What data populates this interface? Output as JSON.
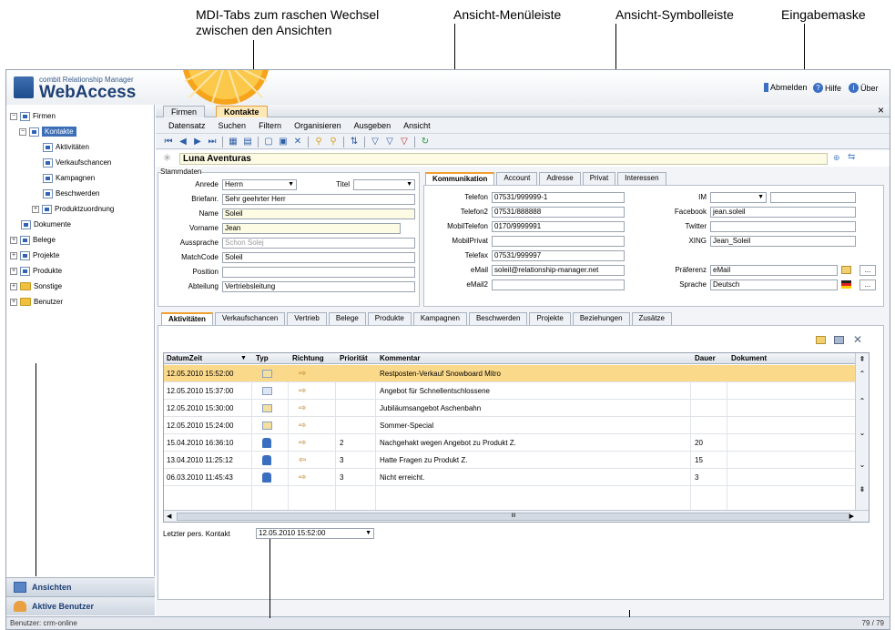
{
  "callouts": {
    "mdi_tabs": "MDI-Tabs zum raschen Wechsel",
    "mdi_tabs_2": "zwischen den Ansichten",
    "menubar": "Ansicht-Menüleiste",
    "toolbar": "Ansicht-Symbolleiste",
    "form": "Eingabemaske"
  },
  "app": {
    "logo_small": "combit Relationship Manager",
    "logo_big": "WebAccess",
    "links": [
      "Abmelden",
      "Hilfe",
      "Über"
    ]
  },
  "tree": {
    "items": [
      {
        "label": "Firmen",
        "pm": "−",
        "icon": "record-icon"
      },
      {
        "label": "Kontakte",
        "pm": "−",
        "icon": "record-icon",
        "selected": true
      },
      {
        "label": "Aktivitäten",
        "icon": "record-icon"
      },
      {
        "label": "Verkaufschancen",
        "icon": "record-icon"
      },
      {
        "label": "Kampagnen",
        "icon": "record-icon"
      },
      {
        "label": "Beschwerden",
        "icon": "record-icon"
      },
      {
        "label": "Produktzuordnung",
        "pm": "+",
        "icon": "record-icon"
      },
      {
        "label": "Dokumente",
        "icon": "record-icon"
      },
      {
        "label": "Belege",
        "pm": "+",
        "icon": "record-icon"
      },
      {
        "label": "Projekte",
        "pm": "+",
        "icon": "record-icon"
      },
      {
        "label": "Produkte",
        "pm": "+",
        "icon": "record-icon"
      },
      {
        "label": "Sonstige",
        "pm": "+",
        "icon": "folder-icon"
      },
      {
        "label": "Benutzer",
        "pm": "+",
        "icon": "folder-icon"
      }
    ],
    "nav_views": "Ansichten",
    "nav_users": "Aktive Benutzer"
  },
  "status": {
    "user": "Benutzer: crm-online",
    "count": "79 / 79"
  },
  "mdi": {
    "tabs": [
      "Firmen",
      "Kontakte"
    ],
    "close": "×"
  },
  "menu": [
    "Datensatz",
    "Suchen",
    "Filtern",
    "Organisieren",
    "Ausgeben",
    "Ansicht"
  ],
  "record": {
    "name": "Luna Aventuras"
  },
  "stamm": {
    "legend": "Stammdaten",
    "anrede_label": "Anrede",
    "anrede": "Herrn",
    "titel_label": "Titel",
    "titel": "",
    "briefanr_label": "Briefanr.",
    "briefanr": "Sehr geehrter Herr",
    "name_label": "Name",
    "name": "Soleil",
    "vorname_label": "Vorname",
    "vorname": "Jean",
    "aussprache_label": "Aussprache",
    "aussprache": "Schon Solej",
    "matchcode_label": "MatchCode",
    "matchcode": "Soleil",
    "position_label": "Position",
    "position": "",
    "abteilung_label": "Abteilung",
    "abteilung": "Vertriebsleitung"
  },
  "comm": {
    "tabs": [
      "Kommunikation",
      "Account",
      "Adresse",
      "Privat",
      "Interessen"
    ],
    "telefon_label": "Telefon",
    "telefon": "07531/999999-1",
    "telefon2_label": "Telefon2",
    "telefon2": "07531/888888",
    "mobil_label": "MobilTelefon",
    "mobil": "0170/9999991",
    "mobilprivat_label": "MobilPrivat",
    "mobilprivat": "",
    "telefax_label": "Telefax",
    "telefax": "07531/999997",
    "email_label": "eMail",
    "email": "soleil@relationship-manager.net",
    "email2_label": "eMail2",
    "email2": "",
    "im_label": "IM",
    "im": "",
    "facebook_label": "Facebook",
    "facebook": "jean.soleil",
    "twitter_label": "Twitter",
    "twitter": "",
    "xing_label": "XING",
    "xing": "Jean_Soleil",
    "praeferenz_label": "Präferenz",
    "praeferenz": "eMail",
    "sprache_label": "Sprache",
    "sprache": "Deutsch",
    "dots": "..."
  },
  "sub": {
    "tabs": [
      "Aktivitäten",
      "Verkaufschancen",
      "Vertrieb",
      "Belege",
      "Produkte",
      "Kampagnen",
      "Beschwerden",
      "Projekte",
      "Beziehungen",
      "Zusätze"
    ]
  },
  "grid": {
    "headers": [
      "DatumZeit",
      "Typ",
      "Richtung",
      "Priorität",
      "Kommentar",
      "Dauer",
      "Dokument"
    ],
    "rows": [
      {
        "dt": "12.05.2010 15:52:00",
        "prio": "",
        "comment": "Restposten-Verkauf Snowboard Mitro",
        "dauer": "",
        "typ": "letter-icon",
        "dir": "outgoing-icon"
      },
      {
        "dt": "12.05.2010 15:37:00",
        "prio": "",
        "comment": "Angebot für Schnellentschlossene",
        "dauer": "",
        "typ": "letter-icon",
        "dir": "outgoing-icon"
      },
      {
        "dt": "12.05.2010 15:30:00",
        "prio": "",
        "comment": "Jubiläumsangebot Aschenbahn",
        "dauer": "",
        "typ": "letter-icon",
        "dir": "outgoing-icon"
      },
      {
        "dt": "12.05.2010 15:24:00",
        "prio": "",
        "comment": "Sommer-Special",
        "dauer": "",
        "typ": "letter-icon",
        "dir": "outgoing-icon"
      },
      {
        "dt": "15.04.2010 16:36:10",
        "prio": "2",
        "comment": "Nachgehakt wegen Angebot zu Produkt Z.",
        "dauer": "20",
        "typ": "phone-icon",
        "dir": "outgoing-icon"
      },
      {
        "dt": "13.04.2010 11:25:12",
        "prio": "3",
        "comment": "Hatte Fragen zu Produkt Z.",
        "dauer": "15",
        "typ": "phone-icon",
        "dir": "incoming-icon"
      },
      {
        "dt": "06.03.2010 11:45:43",
        "prio": "3",
        "comment": "Nicht erreicht.",
        "dauer": "3",
        "typ": "phone-icon",
        "dir": "outgoing-icon"
      }
    ],
    "scroll_mid": "III"
  },
  "last_contact": {
    "label": "Letzter pers. Kontakt",
    "value": "12.05.2010 15:52:00"
  },
  "colors": {
    "accent": "#f0a030",
    "brand": "#1d3f75",
    "selected_row": "#fbd98a"
  }
}
